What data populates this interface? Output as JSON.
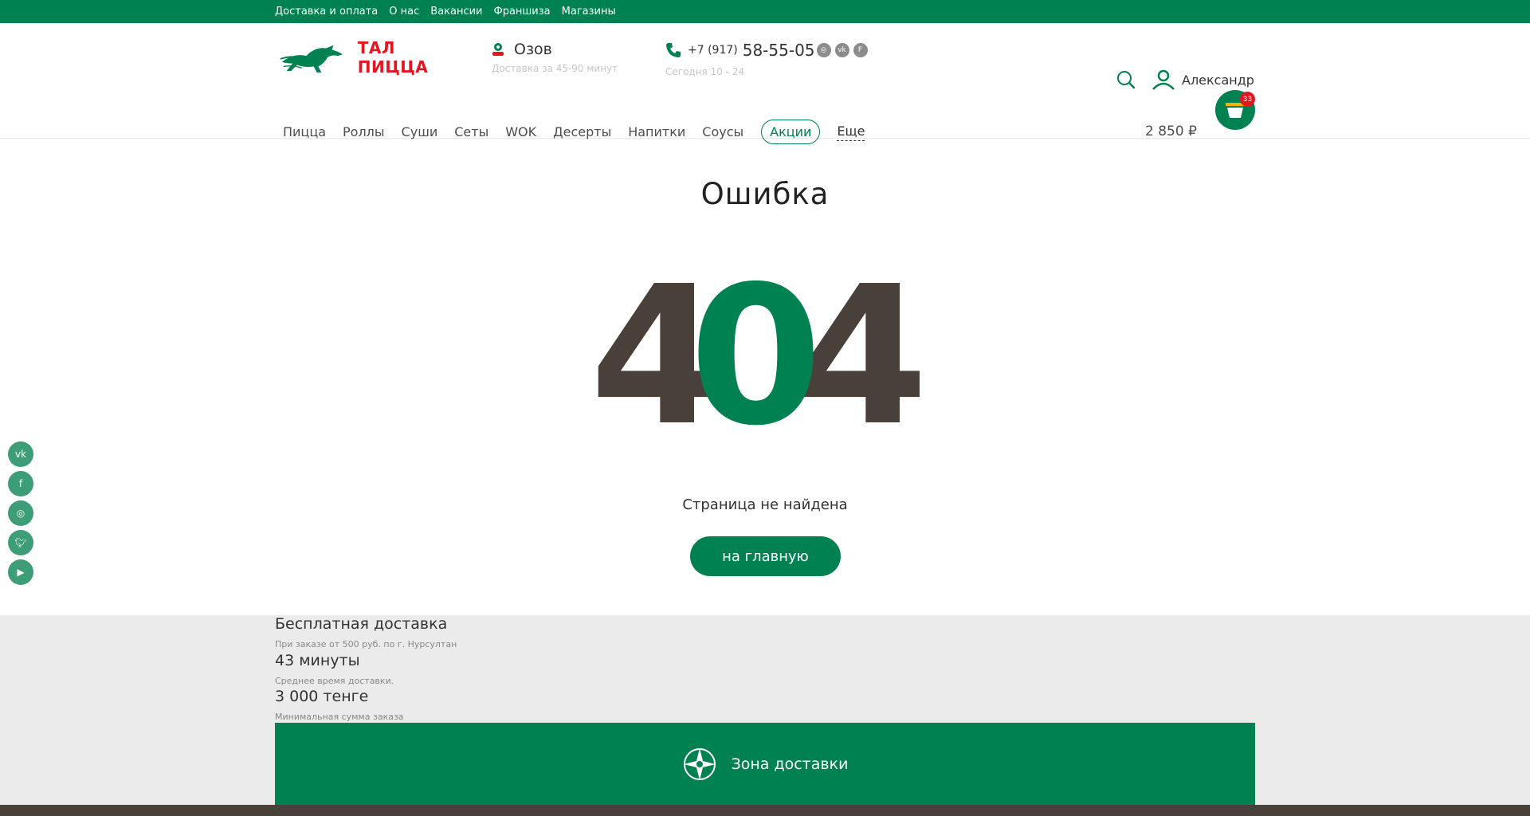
{
  "topbar": {
    "links": [
      "Доставка и оплата",
      "О нас",
      "Вакансии",
      "Франшиза",
      "Магазины"
    ]
  },
  "header": {
    "logo_text": "ТАЛ ПИЦЦА",
    "city": "Озов",
    "delivery_time": "Доставка за 45-90 минут",
    "phone_prefix": "+7 (917)",
    "phone_main": "58-55-05",
    "hours": "Сегодня 10 - 24",
    "social_small": [
      "instagram-icon",
      "vk-icon",
      "foursquare-icon"
    ],
    "user_name": "Александр"
  },
  "nav": {
    "items": [
      "Пицца",
      "Роллы",
      "Суши",
      "Сеты",
      "WOK",
      "Десерты",
      "Напитки",
      "Соусы"
    ],
    "promo": "Акции",
    "more": "Еще"
  },
  "cart": {
    "total": "2 850 ₽",
    "count": "33"
  },
  "side_socials": [
    "vk-icon",
    "facebook-icon",
    "instagram-icon",
    "twitter-icon",
    "youtube-icon"
  ],
  "error": {
    "title": "Ошибка",
    "code": "404",
    "message": "Страница не найдена",
    "home_button": "на главную"
  },
  "info": {
    "blocks": [
      {
        "title": "Бесплатная доставка",
        "sub": "При заказе от 500 руб. по г. Нурсултан"
      },
      {
        "title": "43 минуты",
        "sub": "Среднее время доставки."
      },
      {
        "title": "3 000 тенге",
        "sub": "Минимальная сумма заказа"
      }
    ],
    "zone_button": "Зона доставки"
  },
  "colors": {
    "brand_green": "#008151",
    "brand_red": "#e3151f",
    "digit_dark": "#4a403a",
    "info_bg": "#ebebeb"
  }
}
